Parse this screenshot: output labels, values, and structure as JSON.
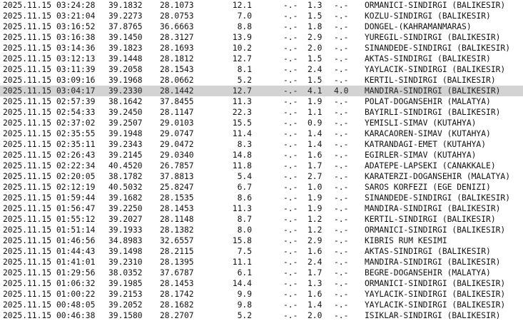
{
  "rows": [
    {
      "date": "2025.11.15",
      "time": "03:24:28",
      "lat": "39.1832",
      "lon": "28.1073",
      "depth": "12.1",
      "md": "-.-",
      "ml": "1.3",
      "mw": "-.-",
      "place": "ORMANICI-SINDIRGI (BALIKESIR)"
    },
    {
      "date": "2025.11.15",
      "time": "03:21:04",
      "lat": "39.2273",
      "lon": "28.0753",
      "depth": "7.0",
      "md": "-.-",
      "ml": "1.5",
      "mw": "-.-",
      "place": "KOZLU-SINDIRGI (BALIKESIR)"
    },
    {
      "date": "2025.11.15",
      "time": "03:16:52",
      "lat": "37.8765",
      "lon": "36.6663",
      "depth": "8.8",
      "md": "-.-",
      "ml": "1.8",
      "mw": "-.-",
      "place": "DONGEL-(KAHRAMANMARAS)"
    },
    {
      "date": "2025.11.15",
      "time": "03:16:38",
      "lat": "39.1450",
      "lon": "28.3127",
      "depth": "13.9",
      "md": "-.-",
      "ml": "2.9",
      "mw": "-.-",
      "place": "YUREGIL-SINDIRGI (BALIKESIR)"
    },
    {
      "date": "2025.11.15",
      "time": "03:14:36",
      "lat": "39.1823",
      "lon": "28.1693",
      "depth": "10.2",
      "md": "-.-",
      "ml": "2.0",
      "mw": "-.-",
      "place": "SINANDEDE-SINDIRGI (BALIKESIR)"
    },
    {
      "date": "2025.11.15",
      "time": "03:12:13",
      "lat": "39.1448",
      "lon": "28.1812",
      "depth": "12.7",
      "md": "-.-",
      "ml": "1.5",
      "mw": "-.-",
      "place": "AKTAS-SINDIRGI (BALIKESIR)"
    },
    {
      "date": "2025.11.15",
      "time": "03:11:39",
      "lat": "39.2058",
      "lon": "28.1543",
      "depth": "8.1",
      "md": "-.-",
      "ml": "2.4",
      "mw": "-.-",
      "place": "YAYLACIK-SINDIRGI (BALIKESIR)"
    },
    {
      "date": "2025.11.15",
      "time": "03:09:16",
      "lat": "39.1968",
      "lon": "28.0662",
      "depth": "5.2",
      "md": "-.-",
      "ml": "1.5",
      "mw": "-.-",
      "place": "KERTIL-SINDIRGI (BALIKESIR)"
    },
    {
      "date": "2025.11.15",
      "time": "03:04:17",
      "lat": "39.2330",
      "lon": "28.1442",
      "depth": "12.7",
      "md": "-.-",
      "ml": "4.1",
      "mw": "4.0",
      "place": "MANDIRA-SINDIRGI (BALIKESIR)",
      "selected": true
    },
    {
      "date": "2025.11.15",
      "time": "02:57:39",
      "lat": "38.1642",
      "lon": "37.8455",
      "depth": "11.3",
      "md": "-.-",
      "ml": "1.9",
      "mw": "-.-",
      "place": "POLAT-DOGANSEHIR (MALATYA)"
    },
    {
      "date": "2025.11.15",
      "time": "02:54:33",
      "lat": "39.2450",
      "lon": "28.1147",
      "depth": "22.3",
      "md": "-.-",
      "ml": "1.1",
      "mw": "-.-",
      "place": "BAYIRLI-SINDIRGI (BALIKESIR)"
    },
    {
      "date": "2025.11.15",
      "time": "02:37:02",
      "lat": "39.2507",
      "lon": "29.0103",
      "depth": "15.5",
      "md": "-.-",
      "ml": "0.9",
      "mw": "-.-",
      "place": "YEMISLI-SIMAV (KUTAHYA)"
    },
    {
      "date": "2025.11.15",
      "time": "02:35:55",
      "lat": "39.1948",
      "lon": "29.0747",
      "depth": "11.4",
      "md": "-.-",
      "ml": "1.4",
      "mw": "-.-",
      "place": "KARACAOREN-SIMAV (KUTAHYA)"
    },
    {
      "date": "2025.11.15",
      "time": "02:35:11",
      "lat": "39.2343",
      "lon": "29.0472",
      "depth": "8.3",
      "md": "-.-",
      "ml": "1.4",
      "mw": "-.-",
      "place": "KATRANDAGI-EMET (KUTAHYA)"
    },
    {
      "date": "2025.11.15",
      "time": "02:26:43",
      "lat": "39.2145",
      "lon": "29.0340",
      "depth": "14.8",
      "md": "-.-",
      "ml": "1.6",
      "mw": "-.-",
      "place": "EGIRLER-SIMAV (KUTAHYA)"
    },
    {
      "date": "2025.11.15",
      "time": "02:22:34",
      "lat": "40.4520",
      "lon": "26.7857",
      "depth": "11.8",
      "md": "-.-",
      "ml": "1.7",
      "mw": "-.-",
      "place": "ADATEPE-LAPSEKI (CANAKKALE)"
    },
    {
      "date": "2025.11.15",
      "time": "02:20:05",
      "lat": "38.1782",
      "lon": "37.8813",
      "depth": "5.4",
      "md": "-.-",
      "ml": "2.7",
      "mw": "-.-",
      "place": "KARATERZI-DOGANSEHIR (MALATYA)"
    },
    {
      "date": "2025.11.15",
      "time": "02:12:19",
      "lat": "40.5032",
      "lon": "25.8247",
      "depth": "6.7",
      "md": "-.-",
      "ml": "1.0",
      "mw": "-.-",
      "place": "SAROS KORFEZI (EGE DENIZI)"
    },
    {
      "date": "2025.11.15",
      "time": "01:59:44",
      "lat": "39.1682",
      "lon": "28.1535",
      "depth": "8.6",
      "md": "-.-",
      "ml": "1.9",
      "mw": "-.-",
      "place": "SINANDEDE-SINDIRGI (BALIKESIR)"
    },
    {
      "date": "2025.11.15",
      "time": "01:56:47",
      "lat": "39.2250",
      "lon": "28.1453",
      "depth": "11.3",
      "md": "-.-",
      "ml": "1.9",
      "mw": "-.-",
      "place": "MANDIRA-SINDIRGI (BALIKESIR)"
    },
    {
      "date": "2025.11.15",
      "time": "01:55:12",
      "lat": "39.2027",
      "lon": "28.1148",
      "depth": "8.7",
      "md": "-.-",
      "ml": "1.2",
      "mw": "-.-",
      "place": "KERTIL-SINDIRGI (BALIKESIR)"
    },
    {
      "date": "2025.11.15",
      "time": "01:51:14",
      "lat": "39.1933",
      "lon": "28.1382",
      "depth": "8.0",
      "md": "-.-",
      "ml": "1.2",
      "mw": "-.-",
      "place": "ORMANICI-SINDIRGI (BALIKESIR)"
    },
    {
      "date": "2025.11.15",
      "time": "01:46:56",
      "lat": "34.8983",
      "lon": "32.6557",
      "depth": "15.8",
      "md": "-.-",
      "ml": "2.9",
      "mw": "-.-",
      "place": "KIBRIS RUM KESIMI"
    },
    {
      "date": "2025.11.15",
      "time": "01:44:43",
      "lat": "39.1498",
      "lon": "28.2115",
      "depth": "7.5",
      "md": "-.-",
      "ml": "1.6",
      "mw": "-.-",
      "place": "AKTAS-SINDIRGI (BALIKESIR)"
    },
    {
      "date": "2025.11.15",
      "time": "01:41:01",
      "lat": "39.2310",
      "lon": "28.1395",
      "depth": "11.1",
      "md": "-.-",
      "ml": "2.4",
      "mw": "-.-",
      "place": "MANDIRA-SINDIRGI (BALIKESIR)"
    },
    {
      "date": "2025.11.15",
      "time": "01:29:56",
      "lat": "38.0352",
      "lon": "37.6787",
      "depth": "6.1",
      "md": "-.-",
      "ml": "1.7",
      "mw": "-.-",
      "place": "BEGRE-DOGANSEHIR (MALATYA)"
    },
    {
      "date": "2025.11.15",
      "time": "01:06:32",
      "lat": "39.1985",
      "lon": "28.1453",
      "depth": "14.4",
      "md": "-.-",
      "ml": "1.3",
      "mw": "-.-",
      "place": "ORMANICI-SINDIRGI (BALIKESIR)"
    },
    {
      "date": "2025.11.15",
      "time": "01:00:22",
      "lat": "39.2153",
      "lon": "28.1742",
      "depth": "9.9",
      "md": "-.-",
      "ml": "1.6",
      "mw": "-.-",
      "place": "YAYLACIK-SINDIRGI (BALIKESIR)"
    },
    {
      "date": "2025.11.15",
      "time": "00:48:05",
      "lat": "39.2052",
      "lon": "28.1682",
      "depth": "9.8",
      "md": "-.-",
      "ml": "1.4",
      "mw": "-.-",
      "place": "YAYLACIK-SINDIRGI (BALIKESIR)"
    },
    {
      "date": "2025.11.15",
      "time": "00:46:38",
      "lat": "39.1580",
      "lon": "28.2707",
      "depth": "5.2",
      "md": "-.-",
      "ml": "2.0",
      "mw": "-.-",
      "place": "ISIKLAR-SINDIRGI (BALIKESIR)"
    }
  ]
}
